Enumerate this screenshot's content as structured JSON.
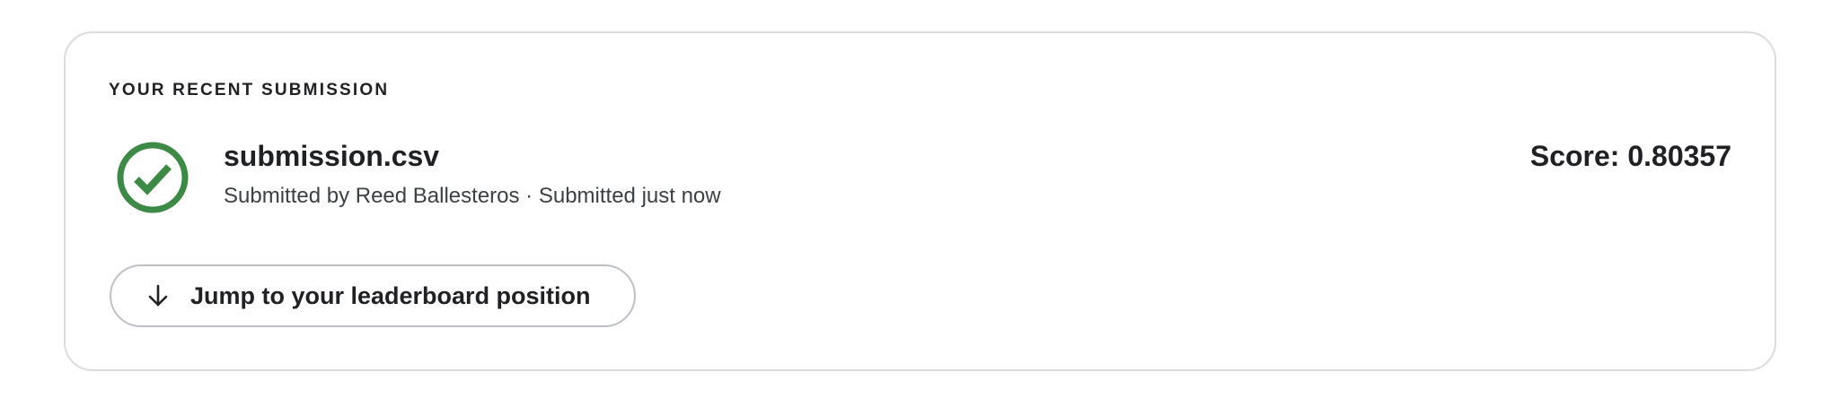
{
  "card": {
    "section_label": "YOUR RECENT SUBMISSION",
    "status_icon": "check-circle-icon",
    "file_name": "submission.csv",
    "meta_text": "Submitted by Reed Ballesteros · Submitted just now",
    "score_text": "Score: 0.80357",
    "jump_button": {
      "icon": "arrow-down-icon",
      "label": "Jump to your leaderboard position"
    }
  },
  "colors": {
    "success": "#3d8a46",
    "text": "#202124",
    "border": "#dadce0"
  }
}
